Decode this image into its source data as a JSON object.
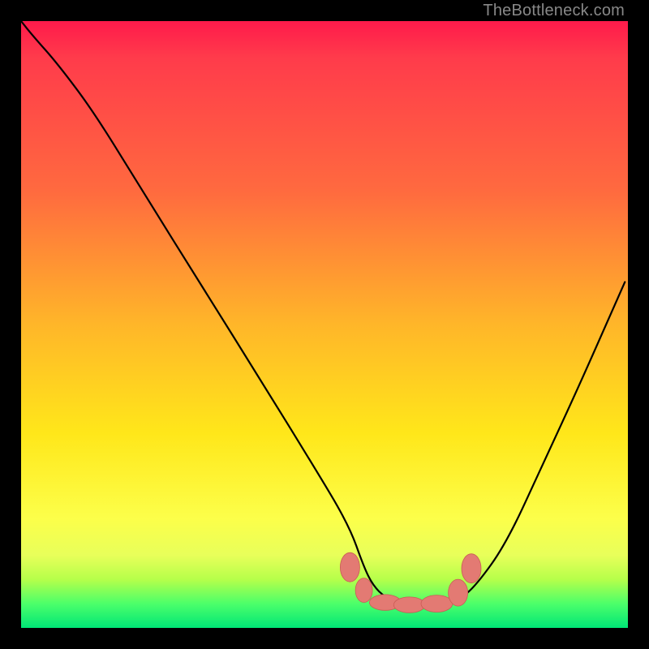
{
  "watermark": "TheBottleneck.com",
  "colors": {
    "curve": "#000000",
    "marker_fill": "#e37a73",
    "marker_stroke": "#c95c55",
    "bg_top": "#ff1a4b",
    "bg_bottom": "#00e676",
    "frame": "#000000"
  },
  "chart_data": {
    "type": "line",
    "title": "",
    "xlabel": "",
    "ylabel": "",
    "xlim": [
      0,
      100
    ],
    "ylim": [
      0,
      100
    ],
    "grid": false,
    "legend": false,
    "note": "Axes are percentage of plot area; y=100 at top. Curve is a single black path. Salmon rounded markers highlight flat minimum.",
    "series": [
      {
        "name": "curve",
        "x": [
          0,
          2,
          6,
          12,
          20,
          30,
          40,
          48,
          54,
          56.5,
          58,
          60,
          63,
          66,
          69,
          72,
          75,
          80,
          86,
          92,
          99.5
        ],
        "y": [
          100,
          97.5,
          93,
          85,
          72,
          56,
          40,
          27,
          17,
          10,
          7,
          5,
          4,
          3.8,
          3.8,
          4.5,
          7,
          14,
          27,
          40,
          57
        ]
      }
    ],
    "markers": [
      {
        "x": 54.2,
        "y": 10.0,
        "rx": 1.6,
        "ry": 2.4
      },
      {
        "x": 56.5,
        "y": 6.2,
        "rx": 1.4,
        "ry": 2.0
      },
      {
        "x": 60.0,
        "y": 4.2,
        "rx": 2.6,
        "ry": 1.3
      },
      {
        "x": 64.0,
        "y": 3.8,
        "rx": 2.6,
        "ry": 1.3
      },
      {
        "x": 68.5,
        "y": 4.0,
        "rx": 2.6,
        "ry": 1.4
      },
      {
        "x": 72.0,
        "y": 5.8,
        "rx": 1.6,
        "ry": 2.2
      },
      {
        "x": 74.2,
        "y": 9.8,
        "rx": 1.6,
        "ry": 2.4
      }
    ]
  }
}
